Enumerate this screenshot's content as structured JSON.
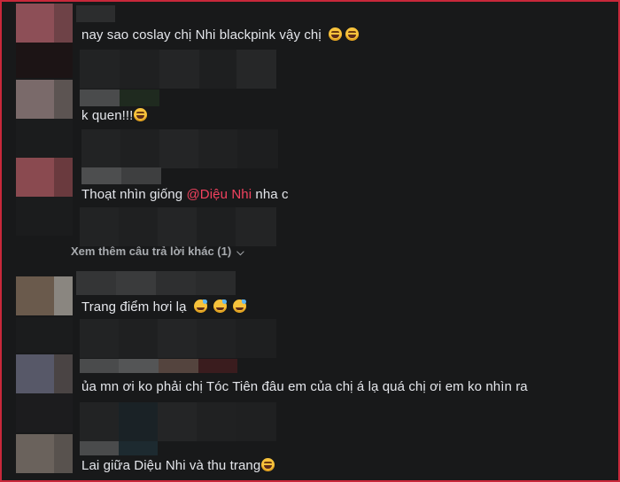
{
  "comments": [
    {
      "text": "nay sao coslay chị Nhi blackpink vậy chị",
      "emoji": [
        "laugh-emoji",
        "laugh-emoji"
      ]
    },
    {
      "text": "k quen!!!",
      "emoji": [
        "laugh-emoji"
      ]
    },
    {
      "text_before": "Thoạt nhìn giống ",
      "mention": "@Diệu Nhi",
      "text_after": " nha c"
    },
    {
      "text": "Trang điểm hơi lạ",
      "emoji": [
        "sweat-smile-emoji",
        "sweat-smile-emoji",
        "sweat-smile-emoji"
      ]
    },
    {
      "text": "ủa mn ơi ko phải chị Tóc Tiên đâu em của chị á lạ quá chị ơi em ko nhìn ra"
    },
    {
      "text": "Lai giữa Diệu Nhi và thu trang",
      "emoji": [
        "laugh-emoji"
      ]
    }
  ],
  "more_replies": {
    "label": "Xem thêm câu trả lời khác (1)",
    "icon": "chevron-down-icon"
  },
  "colors": {
    "background": "#18191a",
    "text": "#e4e6eb",
    "mention": "#f3425f",
    "muted": "#a8abaf",
    "border": "#c8283a"
  }
}
